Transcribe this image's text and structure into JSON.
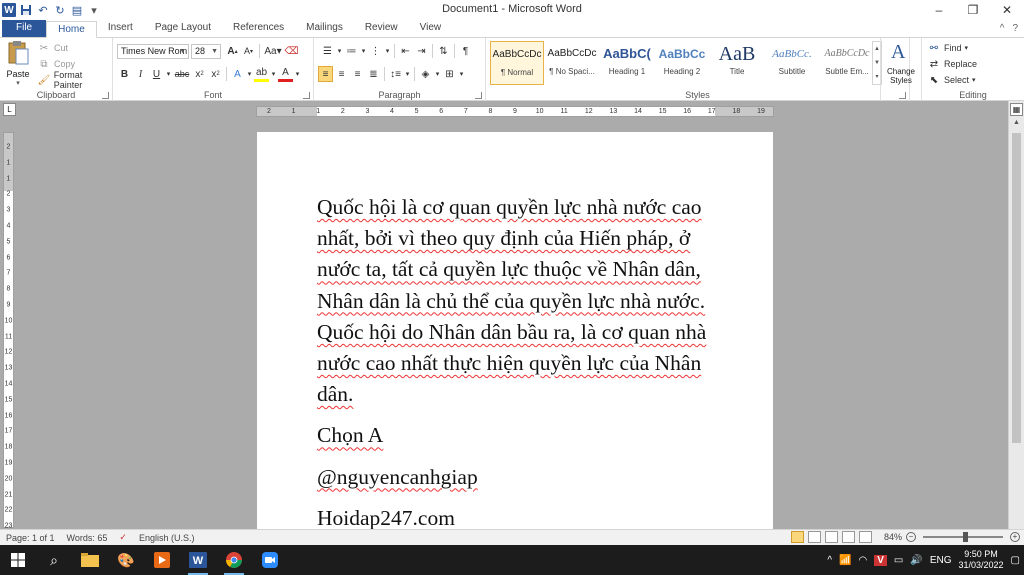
{
  "window": {
    "title": "Document1 - Microsoft Word",
    "controls": [
      "–",
      "❐",
      "✕"
    ]
  },
  "tabs": [
    {
      "label": "File"
    },
    {
      "label": "Home"
    },
    {
      "label": "Insert"
    },
    {
      "label": "Page Layout"
    },
    {
      "label": "References"
    },
    {
      "label": "Mailings"
    },
    {
      "label": "Review"
    },
    {
      "label": "View"
    }
  ],
  "ribbon": {
    "clipboard": {
      "label": "Clipboard",
      "paste": "Paste",
      "cut": "Cut",
      "copy": "Copy",
      "format_painter": "Format Painter"
    },
    "font": {
      "label": "Font",
      "font_name": "Times New Rom",
      "font_size": "28"
    },
    "paragraph": {
      "label": "Paragraph"
    },
    "styles": {
      "label": "Styles",
      "items": [
        {
          "sample": "AaBbCcDc",
          "name": "¶ Normal"
        },
        {
          "sample": "AaBbCcDc",
          "name": "¶ No Spaci..."
        },
        {
          "sample": "AaBbC(",
          "name": "Heading 1"
        },
        {
          "sample": "AaBbCc",
          "name": "Heading 2"
        },
        {
          "sample": "AaB",
          "name": "Title"
        },
        {
          "sample": "AaBbCc.",
          "name": "Subtitle"
        },
        {
          "sample": "AaBbCcDc",
          "name": "Subtle Em..."
        }
      ],
      "change_styles": "Change Styles"
    },
    "editing": {
      "label": "Editing",
      "find": "Find",
      "replace": "Replace",
      "select": "Select"
    }
  },
  "ruler": {
    "h_ticks": [
      "2",
      "1",
      "1",
      "2",
      "3",
      "4",
      "5",
      "6",
      "7",
      "8",
      "9",
      "10",
      "11",
      "12",
      "13",
      "14",
      "15",
      "16",
      "17",
      "18",
      "19"
    ],
    "v_ticks": [
      "2",
      "1",
      "1",
      "2",
      "3",
      "4",
      "5",
      "6",
      "7",
      "8",
      "9",
      "10",
      "11",
      "12",
      "13",
      "14",
      "15",
      "16",
      "17",
      "18",
      "19",
      "20",
      "21",
      "22",
      "23"
    ]
  },
  "document": {
    "paragraph": "Quốc hội là cơ quan quyền lực nhà nước cao nhất, bởi vì theo quy định của Hiến pháp, ở nước ta, tất cả quyền lực thuộc về Nhân dân, Nhân dân là chủ thể của quyền lực nhà nước. Quốc hội do Nhân dân bầu ra, là cơ quan nhà nước cao nhất thực hiện quyền lực của Nhân dân.",
    "answer": "Chọn A",
    "author": "@nguyencanhgiap",
    "site": "Hoidap247.com"
  },
  "status": {
    "page": "Page: 1 of 1",
    "words": "Words: 65",
    "language": "English (U.S.)",
    "zoom": "84%"
  },
  "taskbar": {
    "language": "ENG",
    "time": "9:50 PM",
    "date": "31/03/2022"
  }
}
